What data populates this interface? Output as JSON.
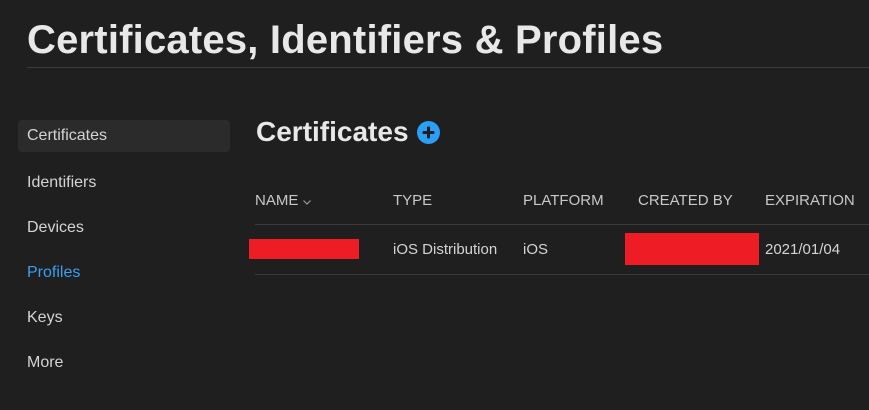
{
  "header": {
    "title": "Certificates, Identifiers & Profiles"
  },
  "sidebar": {
    "items": [
      {
        "label": "Certificates",
        "selected": true
      },
      {
        "label": "Identifiers"
      },
      {
        "label": "Devices"
      },
      {
        "label": "Profiles",
        "active": true
      },
      {
        "label": "Keys"
      },
      {
        "label": "More"
      }
    ]
  },
  "main": {
    "section_title": "Certificates",
    "add_icon": "plus-circle-icon",
    "table": {
      "columns": [
        "NAME",
        "TYPE",
        "PLATFORM",
        "CREATED BY",
        "EXPIRATION"
      ],
      "sorted_column": "NAME",
      "sort_icon": "chevron-down-icon",
      "rows": [
        {
          "name": "",
          "type": "iOS Distribution",
          "platform": "iOS",
          "created_by": "",
          "expiration": "2021/01/04"
        }
      ]
    }
  },
  "colors": {
    "background": "#1e1f1e",
    "accent": "#3b9ff2",
    "redaction": "#ee1c25"
  }
}
